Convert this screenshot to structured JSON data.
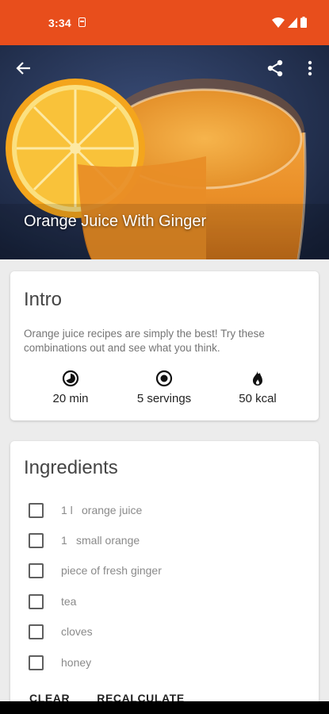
{
  "status_bar": {
    "time": "3:34",
    "background": "#e84e1c"
  },
  "toolbar": {
    "back_icon": "arrow-back-icon",
    "share_icon": "share-icon",
    "menu_icon": "more-vert-icon"
  },
  "recipe": {
    "title": "Orange Juice With Ginger"
  },
  "intro": {
    "heading": "Intro",
    "text": "Orange juice recipes are simply the best! Try these combinations out and see what you think.",
    "stats": [
      {
        "icon": "timer-icon",
        "label": "20 min"
      },
      {
        "icon": "servings-icon",
        "label": "5 servings"
      },
      {
        "icon": "flame-icon",
        "label": "50 kcal"
      }
    ]
  },
  "ingredients": {
    "heading": "Ingredients",
    "items": [
      {
        "qty": "1 l",
        "name": "orange juice",
        "checked": false
      },
      {
        "qty": "1",
        "name": "small orange",
        "checked": false
      },
      {
        "qty": "",
        "name": "piece of fresh ginger",
        "checked": false
      },
      {
        "qty": "",
        "name": "tea",
        "checked": false
      },
      {
        "qty": "",
        "name": "cloves",
        "checked": false
      },
      {
        "qty": "",
        "name": "honey",
        "checked": false
      }
    ],
    "clear_label": "CLEAR",
    "recalculate_label": "RECALCULATE"
  }
}
